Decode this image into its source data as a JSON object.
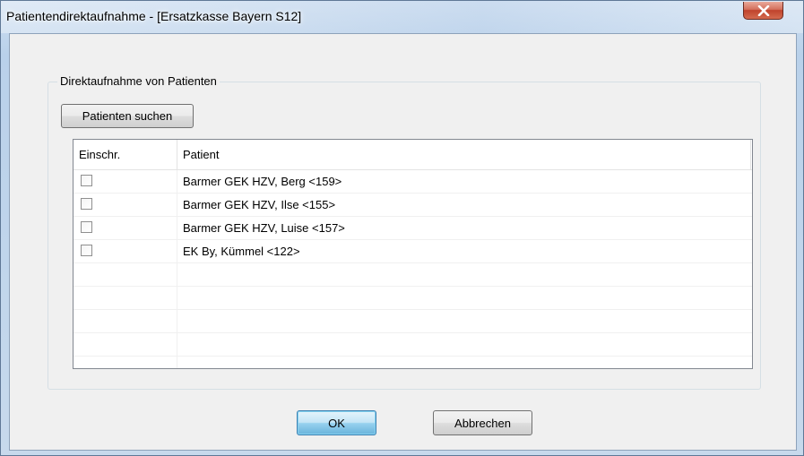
{
  "window": {
    "title": "Patientendirektaufnahme - [Ersatzkasse Bayern S12]",
    "close_icon": "close-x-icon"
  },
  "group": {
    "label": "Direktaufnahme von Patienten",
    "search_button_label": "Patienten suchen"
  },
  "table": {
    "columns": [
      "Einschr.",
      "Patient"
    ],
    "rows": [
      {
        "checked": false,
        "patient": "Barmer GEK HZV,  Berg <159>"
      },
      {
        "checked": false,
        "patient": "Barmer GEK HZV,  Ilse <155>"
      },
      {
        "checked": false,
        "patient": "Barmer GEK HZV,  Luise <157>"
      },
      {
        "checked": false,
        "patient": "EK By,  Kümmel <122>"
      },
      {
        "checked": false,
        "patient": ""
      },
      {
        "checked": false,
        "patient": ""
      },
      {
        "checked": false,
        "patient": ""
      },
      {
        "checked": false,
        "patient": ""
      }
    ]
  },
  "footer": {
    "ok_label": "OK",
    "cancel_label": "Abbrechen"
  }
}
